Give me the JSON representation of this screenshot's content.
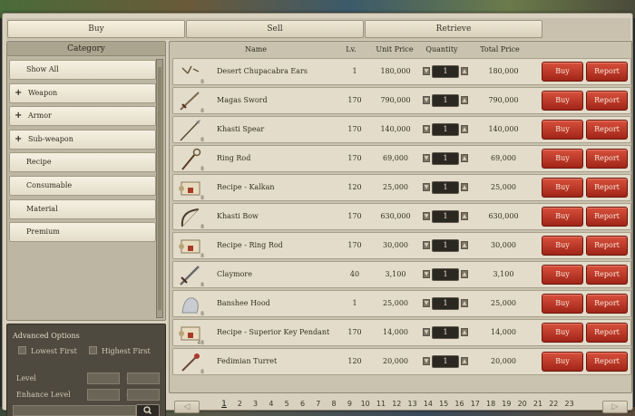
{
  "tabs": [
    {
      "label": "Buy",
      "active": true
    },
    {
      "label": "Sell",
      "active": false
    },
    {
      "label": "Retrieve",
      "active": false
    }
  ],
  "category": {
    "header": "Category",
    "items": [
      {
        "label": "Show All",
        "expandable": false
      },
      {
        "label": "Weapon",
        "expandable": true
      },
      {
        "label": "Armor",
        "expandable": true
      },
      {
        "label": "Sub-weapon",
        "expandable": true
      },
      {
        "label": "Recipe",
        "expandable": false
      },
      {
        "label": "Consumable",
        "expandable": false
      },
      {
        "label": "Material",
        "expandable": false
      },
      {
        "label": "Premium",
        "expandable": false
      }
    ]
  },
  "advanced": {
    "title": "Advanced Options",
    "lowest_first": "Lowest First",
    "highest_first": "Highest First",
    "level_label": "Level",
    "enhance_label": "Enhance Level",
    "dash": "-"
  },
  "table": {
    "headers": {
      "name": "Name",
      "level": "Lv.",
      "unit_price": "Unit Price",
      "quantity": "Quantity",
      "total_price": "Total Price"
    },
    "buy_label": "Buy",
    "report_label": "Report",
    "rows": [
      {
        "name": "Desert Chupacabra Ears",
        "level": "1",
        "unit_price": "180,000",
        "quantity": "1",
        "total_price": "180,000",
        "icon": "ears-icon",
        "grade": "8"
      },
      {
        "name": "Magas Sword",
        "level": "170",
        "unit_price": "790,000",
        "quantity": "1",
        "total_price": "790,000",
        "icon": "sword-icon",
        "grade": "8"
      },
      {
        "name": "Khasti Spear",
        "level": "170",
        "unit_price": "140,000",
        "quantity": "1",
        "total_price": "140,000",
        "icon": "spear-icon",
        "grade": "8"
      },
      {
        "name": "Ring Rod",
        "level": "170",
        "unit_price": "69,000",
        "quantity": "1",
        "total_price": "69,000",
        "icon": "rod-icon",
        "grade": "8"
      },
      {
        "name": "Recipe - Kalkan",
        "level": "120",
        "unit_price": "25,000",
        "quantity": "1",
        "total_price": "25,000",
        "icon": "scroll-icon",
        "grade": "8"
      },
      {
        "name": "Khasti Bow",
        "level": "170",
        "unit_price": "630,000",
        "quantity": "1",
        "total_price": "630,000",
        "icon": "bow-icon",
        "grade": "8"
      },
      {
        "name": "Recipe - Ring Rod",
        "level": "170",
        "unit_price": "30,000",
        "quantity": "1",
        "total_price": "30,000",
        "icon": "scroll-icon",
        "grade": "8"
      },
      {
        "name": "Claymore",
        "level": "40",
        "unit_price": "3,100",
        "quantity": "1",
        "total_price": "3,100",
        "icon": "claymore-icon",
        "grade": "8"
      },
      {
        "name": "Banshee Hood",
        "level": "1",
        "unit_price": "25,000",
        "quantity": "1",
        "total_price": "25,000",
        "icon": "hood-icon",
        "grade": "8"
      },
      {
        "name": "Recipe - Superior Key Pendant",
        "level": "170",
        "unit_price": "14,000",
        "quantity": "1",
        "total_price": "14,000",
        "icon": "scroll-icon",
        "grade": "48"
      },
      {
        "name": "Fedimian Turret",
        "level": "120",
        "unit_price": "20,000",
        "quantity": "1",
        "total_price": "20,000",
        "icon": "turret-icon",
        "grade": "8"
      }
    ]
  },
  "pagination": {
    "prev": "◁",
    "next": "▷",
    "current": 1,
    "pages": [
      "1",
      "2",
      "3",
      "4",
      "5",
      "6",
      "7",
      "8",
      "9",
      "10",
      "11",
      "12",
      "13",
      "14",
      "15",
      "16",
      "17",
      "18",
      "19",
      "20",
      "21",
      "22",
      "23"
    ]
  },
  "colors": {
    "buy_button": "#b8321f",
    "panel": "#d8d1bf",
    "row": "#e3dccb"
  }
}
